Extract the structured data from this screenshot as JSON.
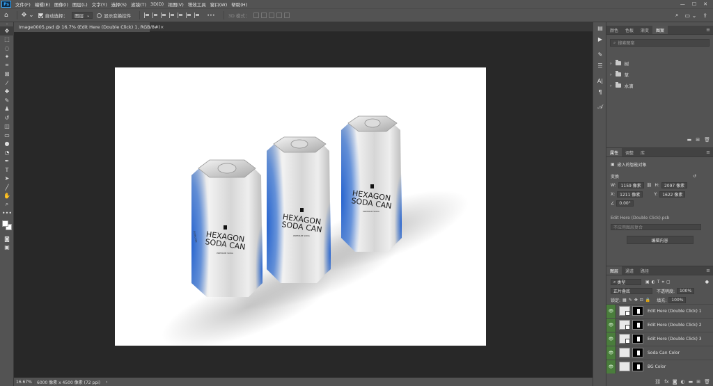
{
  "app": {
    "logo": "Ps"
  },
  "menu": [
    "文件(F)",
    "编辑(E)",
    "图像(I)",
    "图层(L)",
    "文字(Y)",
    "选择(S)",
    "滤镜(T)",
    "3D(D)",
    "视图(V)",
    "增效工具",
    "窗口(W)",
    "帮助(H)"
  ],
  "window_controls": {
    "minimize": "—",
    "maximize": "☐",
    "close": "✕"
  },
  "options_bar": {
    "auto_select_label": "自动选择：",
    "auto_select_checked": true,
    "auto_select_target": "图层",
    "show_transform_label": "显示变换控件",
    "show_transform_checked": false,
    "mode_label": "3D 模式：",
    "more": "•••"
  },
  "document": {
    "tab_title": "Image0005.psd @ 16.7% (Edit Here (Double Click) 1, RGB/8#)",
    "close": "×"
  },
  "status": {
    "zoom": "16.67%",
    "info": "6000 像素 x 4500 像素 (72 ppi)",
    "arrow": "›"
  },
  "panels": {
    "top_tabs": [
      "颜色",
      "色板",
      "渐变",
      "图案"
    ],
    "top_active": 3,
    "search_placeholder": "搜索图案",
    "pattern_groups": [
      "树",
      "草",
      "水滴"
    ],
    "props_tabs": [
      "属性",
      "调整",
      "库"
    ],
    "props_active": 0,
    "props": {
      "object_type": "嵌入的智能对象",
      "section": "变换",
      "w_label": "W:",
      "w_value": "1159 像素",
      "h_label": "H:",
      "h_value": "2097 像素",
      "x_label": "X:",
      "x_value": "1211 像素",
      "y_label": "Y:",
      "y_value": "1622 像素",
      "angle_value": "0.00°",
      "file_name": "Edit Here (Double Click).psb",
      "comp_placeholder": "不应用图层复合",
      "edit_button": "编辑内容"
    },
    "layers_tabs": [
      "图层",
      "通道",
      "路径"
    ],
    "layers_active": 0,
    "layers_filter": "类型",
    "blend_mode": "正片叠底",
    "opacity_label": "不透明度:",
    "opacity_value": "100%",
    "lock_label": "锁定:",
    "fill_label": "填充:",
    "fill_value": "100%",
    "layers": [
      {
        "name": "Edit Here (Double Click) 1",
        "kind": "smart"
      },
      {
        "name": "Edit Here (Double Click) 2",
        "kind": "smart"
      },
      {
        "name": "Edit Here (Double Click) 3",
        "kind": "smart"
      },
      {
        "name": "Soda Can Color",
        "kind": "fill"
      },
      {
        "name": "BG Color",
        "kind": "fill"
      }
    ]
  },
  "cans": {
    "brand_line1": "HEXAGON",
    "brand_line2": "SODA CAN",
    "tagline": "PREMIUM SODA",
    "side_text": "QUENCHER",
    "accent_color": "#2f6fd6"
  }
}
